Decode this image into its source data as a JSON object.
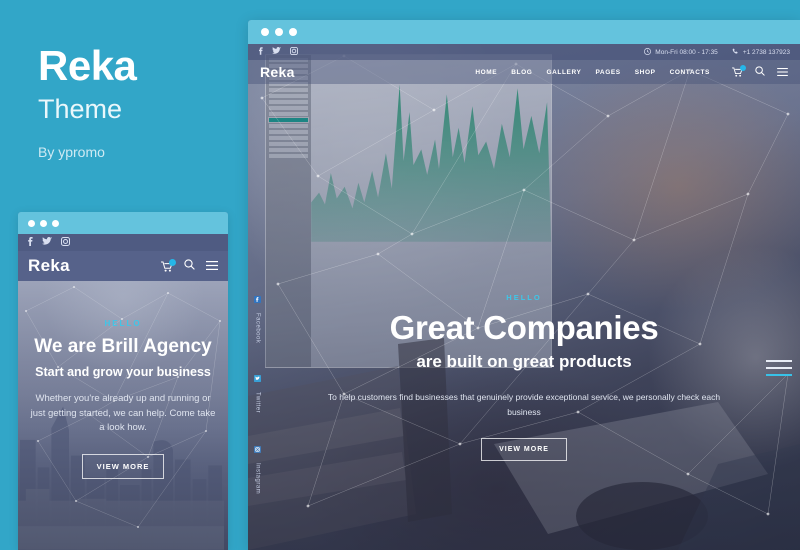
{
  "brand": {
    "title": "Reka",
    "subtitle": "Theme",
    "byline": "By ypromo"
  },
  "colors": {
    "background": "#32a6c8",
    "chrome": "#64c3dd",
    "accent_cyan": "#3fc6e8",
    "badge": "#25b6e8",
    "nav_slate": "#6f7ba4"
  },
  "desktop_mockup": {
    "topbar": {
      "social": [
        {
          "name": "facebook-icon",
          "glyph": "f"
        },
        {
          "name": "twitter-icon",
          "glyph": "t"
        },
        {
          "name": "instagram-icon",
          "glyph": "i"
        }
      ],
      "hours_icon": "clock-icon",
      "hours": "Mon-Fri 08:00 - 17:35",
      "phone_icon": "phone-icon",
      "phone": "+1 2738 137923"
    },
    "header": {
      "logo": "Reka",
      "nav": [
        {
          "label": "HOME"
        },
        {
          "label": "BLOG"
        },
        {
          "label": "GALLERY"
        },
        {
          "label": "PAGES"
        },
        {
          "label": "SHOP"
        },
        {
          "label": "CONTACTS"
        }
      ],
      "icons": [
        {
          "name": "cart-icon"
        },
        {
          "name": "search-icon"
        },
        {
          "name": "menu-icon"
        }
      ],
      "cart_badge": ""
    },
    "hero": {
      "eyebrow": "HELLO",
      "title": "Great Companies",
      "subtitle": "are built on great products",
      "text": "To help customers find businesses that genuinely provide exceptional service, we personally check each business",
      "button": "VIEW MORE"
    },
    "social_rail": [
      {
        "label": "Facebook",
        "icon": "facebook-icon"
      },
      {
        "label": "Twitter",
        "icon": "twitter-icon"
      },
      {
        "label": "Instagram",
        "icon": "instagram-icon"
      }
    ]
  },
  "mobile_mockup": {
    "topbar": {
      "social": [
        {
          "name": "facebook-icon",
          "glyph": "f"
        },
        {
          "name": "twitter-icon",
          "glyph": "t"
        },
        {
          "name": "instagram-icon",
          "glyph": "i"
        }
      ]
    },
    "header": {
      "logo": "Reka",
      "icons": [
        {
          "name": "cart-icon"
        },
        {
          "name": "search-icon"
        },
        {
          "name": "menu-icon"
        }
      ],
      "cart_badge": ""
    },
    "hero": {
      "eyebrow": "HELLO",
      "title": "We are Brill Agency",
      "subtitle": "Start and grow your business",
      "text": "Whether you're already up and running or just getting started, we can help. Come take a look how.",
      "button": "VIEW MORE"
    }
  }
}
